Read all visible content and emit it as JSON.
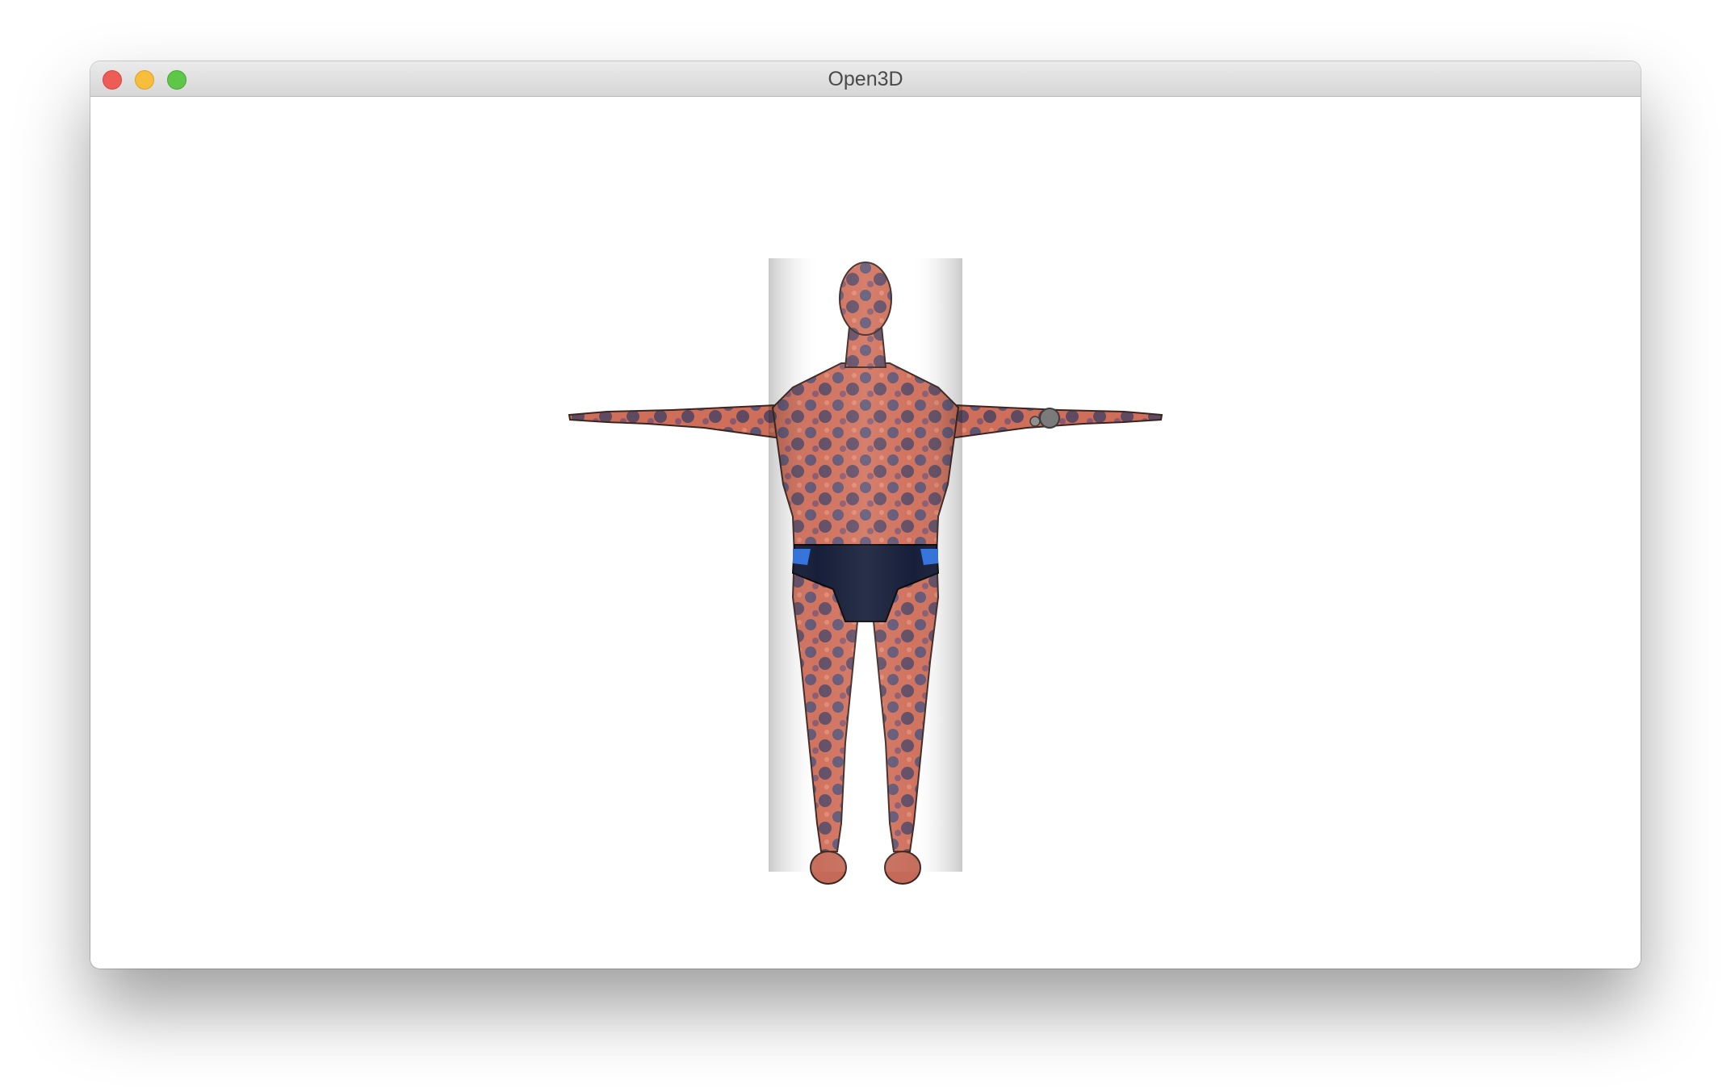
{
  "window": {
    "title": "Open3D",
    "controls": {
      "close_icon": "close-icon",
      "minimize_icon": "minimize-icon",
      "zoom_icon": "zoom-icon"
    }
  },
  "viewport": {
    "background": "#ffffff",
    "model_name": "",
    "colors": {
      "skin": "#cf6f5a",
      "spots": "#3b4a7a",
      "briefs": "#0f1733",
      "briefs_accent": "#2c6fe0"
    }
  }
}
